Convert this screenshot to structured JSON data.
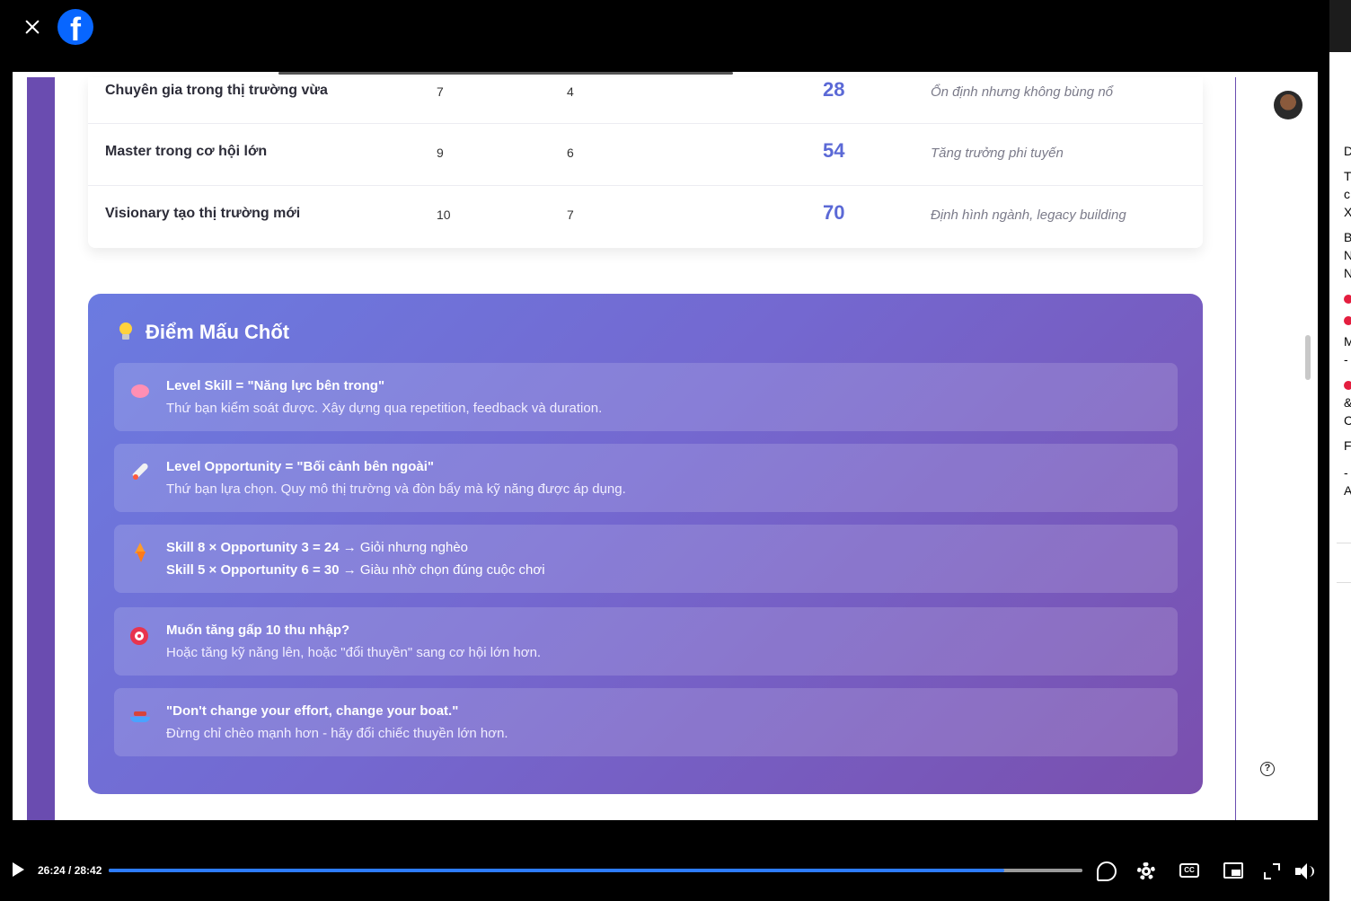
{
  "player": {
    "brand_icon": "facebook-icon",
    "close_icon": "close-icon",
    "time": "26:24 / 28:42",
    "progress_fraction": 0.92,
    "buffer_fraction": 1.0,
    "accent": "#2d7cff"
  },
  "table": {
    "rows": [
      {
        "level": "Chuyên gia trong thị trường vừa",
        "skill": "7",
        "opportunity": "4",
        "result": "28",
        "note": "Ổn định nhưng không bùng nổ"
      },
      {
        "level": "Master trong cơ hội lớn",
        "skill": "9",
        "opportunity": "6",
        "result": "54",
        "note": "Tăng trưởng phi tuyến"
      },
      {
        "level": "Visionary tạo thị trường mới",
        "skill": "10",
        "opportunity": "7",
        "result": "70",
        "note": "Định hình ngành, legacy building"
      }
    ]
  },
  "key_points": {
    "title": "Điểm Mấu Chốt",
    "items": [
      {
        "icon": "brain-icon",
        "title": "Level Skill = \"Năng lực bên trong\"",
        "text": "Thứ bạn kiểm soát được. Xây dựng qua repetition, feedback và duration."
      },
      {
        "icon": "rocket-icon",
        "title": "Level Opportunity = \"Bối cảnh bên ngoài\"",
        "text": "Thứ bạn lựa chọn. Quy mô thị trường và đòn bẩy mà kỹ năng được áp dụng."
      },
      {
        "icon": "bolt-icon",
        "line1_bold": "Skill 8 × Opportunity 3 = 24",
        "line1_rest": " → Giỏi nhưng nghèo",
        "line2_bold": "Skill 5 × Opportunity 6 = 30",
        "line2_rest": " → Giàu nhờ chọn đúng cuộc chơi"
      },
      {
        "icon": "target-icon",
        "title": "Muốn tăng gấp 10 thu nhập?",
        "text": "Hoặc tăng kỹ năng lên, hoặc \"đổi thuyền\" sang cơ hội lớn hơn."
      },
      {
        "icon": "boat-icon",
        "title": "\"Don't change your effort, change your boat.\"",
        "text": "Đừng chỉ chèo mạnh hơn - hãy đổi chiếc thuyền lớn hơn."
      }
    ]
  },
  "sidebar_letters": [
    "D",
    "T",
    "c",
    "X",
    "B",
    "N",
    "N",
    "M",
    "-",
    "&",
    "C",
    "F",
    "-",
    "A"
  ]
}
